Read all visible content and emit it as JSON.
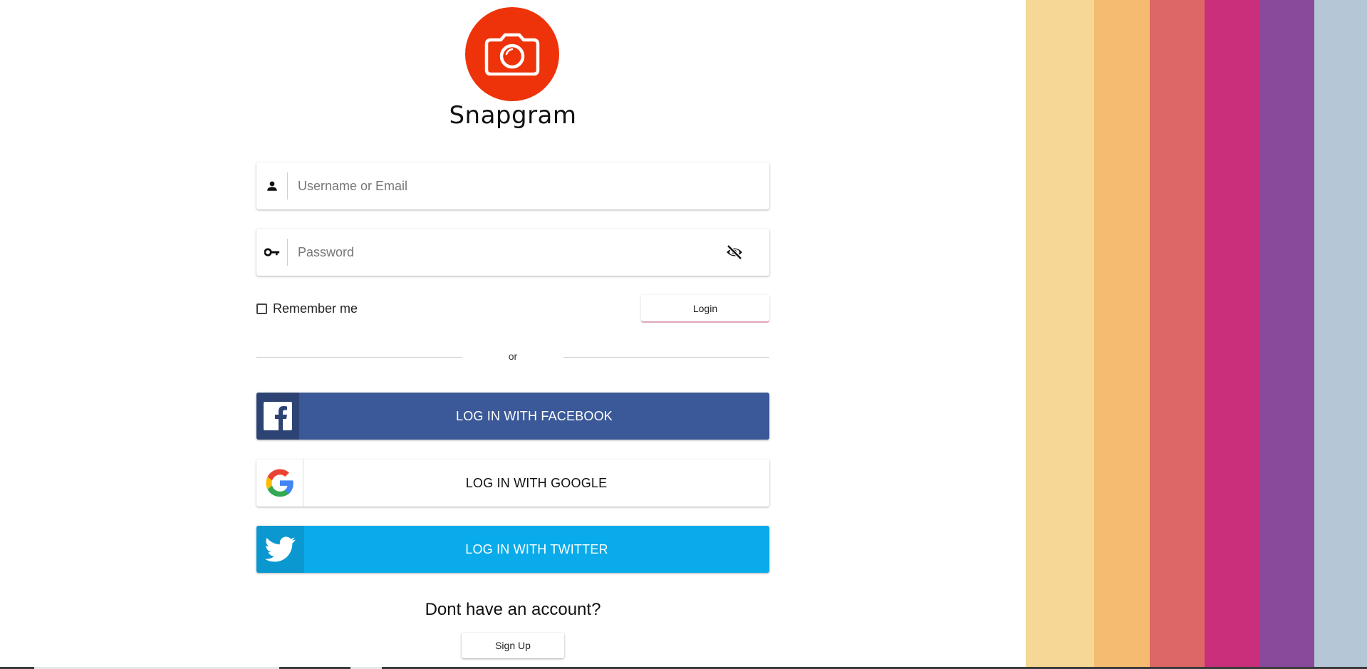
{
  "brand": {
    "name": "Snapgram",
    "logo_icon": "camera-icon",
    "logo_color": "#ee330a"
  },
  "form": {
    "username_placeholder": "Username or Email",
    "username_value": "",
    "password_placeholder": "Password",
    "password_value": "",
    "remember_label": "Remember me",
    "remember_checked": false,
    "login_label": "Login",
    "divider_text": "or"
  },
  "social": {
    "facebook_label": "LOG IN WITH FACEBOOK",
    "google_label": "LOG IN WITH GOOGLE",
    "twitter_label": "LOG IN WITH TWITTER",
    "facebook_color": "#3b5998",
    "twitter_color": "#09abeb"
  },
  "signup": {
    "prompt": "Dont have an account?",
    "button_label": "Sign Up"
  },
  "stripes": [
    {
      "color": "#f6d795"
    },
    {
      "color": "#f5bc71"
    },
    {
      "color": "#dd6766"
    },
    {
      "color": "#c92f7b"
    },
    {
      "color": "#8a4a9c"
    },
    {
      "color": "#b5c6d6"
    }
  ]
}
